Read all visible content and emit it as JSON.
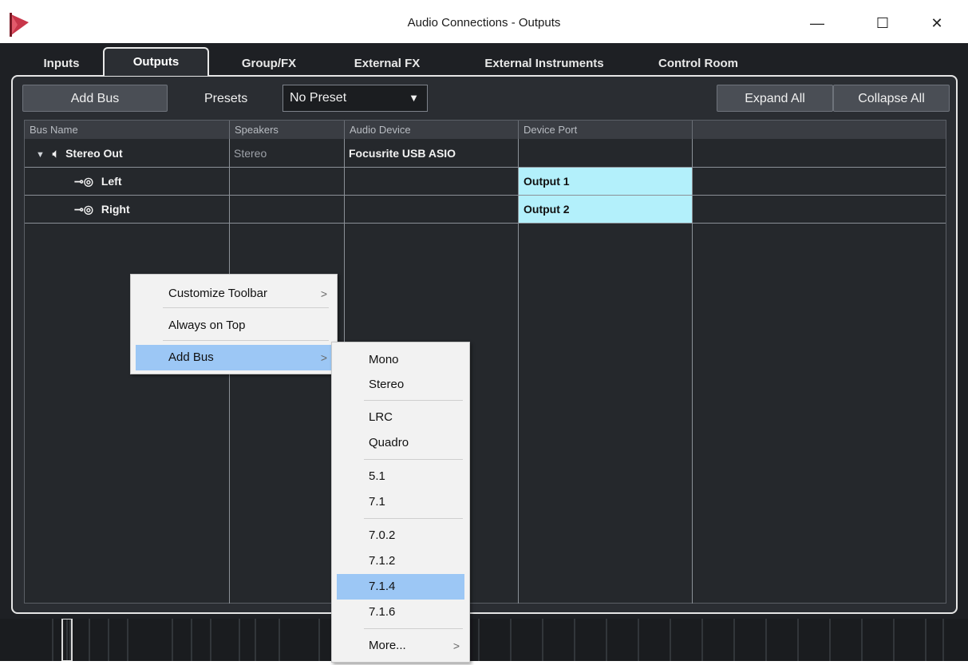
{
  "window": {
    "title": "Audio Connections - Outputs",
    "minimize": "—",
    "maximize": "☐",
    "close": "✕"
  },
  "tabs": [
    "Inputs",
    "Outputs",
    "Group/FX",
    "External FX",
    "External Instruments",
    "Control Room"
  ],
  "active_tab": "Outputs",
  "toolbar": {
    "add_bus": "Add Bus",
    "presets_label": "Presets",
    "preset_value": "No Preset",
    "expand_all": "Expand All",
    "collapse_all": "Collapse All"
  },
  "table": {
    "headers": [
      "Bus Name",
      "Speakers",
      "Audio Device",
      "Device Port"
    ],
    "rows": [
      {
        "name": "Stereo Out",
        "speakers": "Stereo",
        "device": "Focusrite USB ASIO",
        "port": ""
      },
      {
        "name": "Left",
        "speakers": "",
        "device": "",
        "port": "Output 1"
      },
      {
        "name": "Right",
        "speakers": "",
        "device": "",
        "port": "Output 2"
      }
    ]
  },
  "context_menu": {
    "items": [
      "Customize Toolbar",
      "Always on Top",
      "Add Bus"
    ],
    "highlighted": "Add Bus"
  },
  "submenu": {
    "items": [
      "Mono",
      "Stereo",
      "LRC",
      "Quadro",
      "5.1",
      "7.1",
      "7.0.2",
      "7.1.2",
      "7.1.4",
      "7.1.6",
      "More..."
    ],
    "highlighted": "7.1.4"
  },
  "colors": {
    "accent_port": "#b3f0fb",
    "menu_highlight": "#9cc7f5",
    "panel": "#2a2d32"
  }
}
